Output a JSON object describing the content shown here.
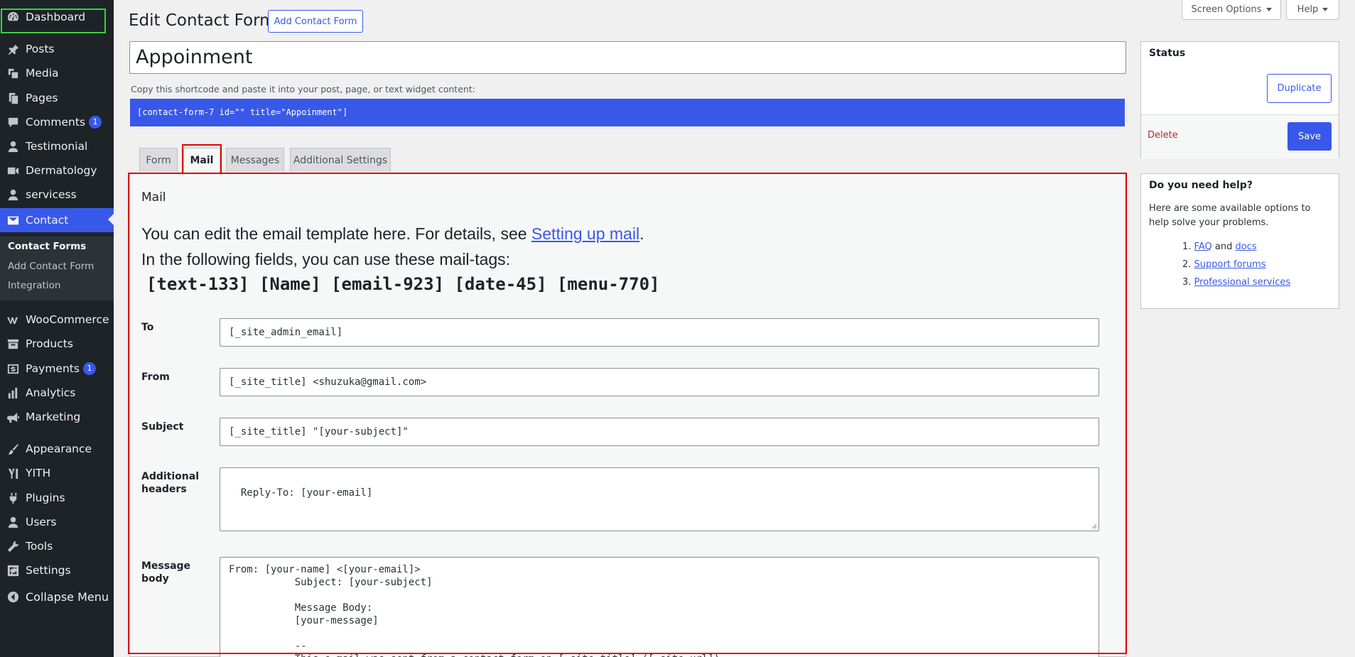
{
  "sidebar": {
    "items": [
      {
        "label": "Dashboard",
        "icon": "dashboard-icon"
      },
      {
        "label": "Posts",
        "icon": "pin-icon"
      },
      {
        "label": "Media",
        "icon": "media-icon"
      },
      {
        "label": "Pages",
        "icon": "pages-icon"
      },
      {
        "label": "Comments",
        "icon": "comment-icon",
        "badge": "1"
      },
      {
        "label": "Testimonial",
        "icon": "person-icon"
      },
      {
        "label": "Dermatology",
        "icon": "video-icon"
      },
      {
        "label": "servicess",
        "icon": "person-icon"
      },
      {
        "label": "Contact",
        "icon": "mail-icon"
      },
      {
        "label": "WooCommerce",
        "icon": "woo-icon"
      },
      {
        "label": "Products",
        "icon": "archive-icon"
      },
      {
        "label": "Payments",
        "icon": "dollar-icon",
        "badge": "1"
      },
      {
        "label": "Analytics",
        "icon": "bar-chart-icon"
      },
      {
        "label": "Marketing",
        "icon": "megaphone-icon"
      },
      {
        "label": "Appearance",
        "icon": "brush-icon"
      },
      {
        "label": "YITH",
        "icon": "yith-icon"
      },
      {
        "label": "Plugins",
        "icon": "plugin-icon"
      },
      {
        "label": "Users",
        "icon": "users-icon"
      },
      {
        "label": "Tools",
        "icon": "wrench-icon"
      },
      {
        "label": "Settings",
        "icon": "settings-icon"
      },
      {
        "label": "Collapse Menu",
        "icon": "collapse-icon"
      }
    ],
    "submenu": [
      "Contact Forms",
      "Add Contact Form",
      "Integration"
    ]
  },
  "header": {
    "title": "Edit Contact Form",
    "add_button": "Add Contact Form",
    "screen_options": "Screen Options",
    "help": "Help"
  },
  "form": {
    "title_value": "Appoinment",
    "shortcode_label": "Copy this shortcode and paste it into your post, page, or text widget content:",
    "shortcode": "[contact-form-7 id=\"\" title=\"Appoinment\"]"
  },
  "tabs": [
    "Form",
    "Mail",
    "Messages",
    "Additional Settings"
  ],
  "mail": {
    "section_title": "Mail",
    "intro_1": "You can edit the email template here. For details, see ",
    "intro_link": "Setting up mail",
    "intro_end": ".",
    "intro_2": "In the following fields, you can use these mail-tags:",
    "mail_tags": "[text-133] [Name] [email-923] [date-45] [menu-770]",
    "fields": {
      "to_label": "To",
      "to_value": "[_site_admin_email]",
      "from_label": "From",
      "from_value": "[_site_title] <shuzuka@gmail.com>",
      "subject_label": "Subject",
      "subject_value": "[_site_title] \"[your-subject]\"",
      "headers_label_1": "Additional",
      "headers_label_2": "headers",
      "headers_value": "Reply-To: [your-email]",
      "body_label_1": "Message",
      "body_label_2": "body",
      "body_value": "From: [your-name] <[your-email]>\n           Subject: [your-subject]\n\n           Message Body:\n           [your-message]\n\n           --\n           This e-mail was sent from a contact form on [_site_title] ([_site_url])"
    }
  },
  "status_box": {
    "title": "Status",
    "duplicate": "Duplicate",
    "delete": "Delete",
    "save": "Save"
  },
  "help_box": {
    "title": "Do you need help?",
    "text": "Here are some available options to help solve your problems.",
    "items": [
      {
        "num": "1.",
        "link1": "FAQ",
        "mid": " and ",
        "link2": "docs"
      },
      {
        "num": "2.",
        "link1": "Support forums"
      },
      {
        "num": "3.",
        "link1": "Professional services"
      }
    ]
  },
  "colors": {
    "sidebar_bg": "#1d2327",
    "accent": "#3858e9",
    "highlight_red": "#e00000",
    "highlight_green": "#3cd13c"
  }
}
